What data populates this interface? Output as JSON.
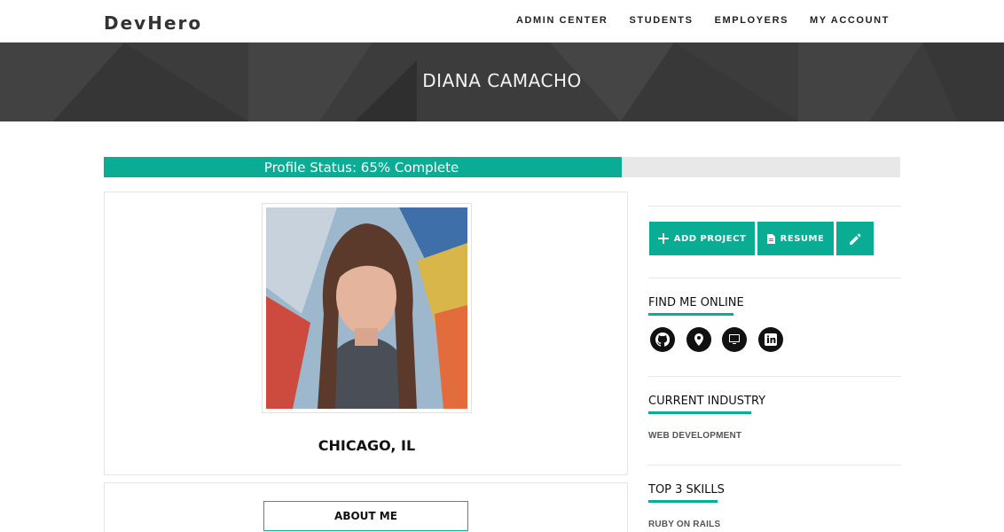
{
  "brand": "DevHero",
  "nav": [
    "ADMIN CENTER",
    "STUDENTS",
    "EMPLOYERS",
    "MY ACCOUNT"
  ],
  "banner": {
    "title": "DIANA CAMACHO"
  },
  "profile_status": {
    "label": "Profile Status:  65% Complete",
    "percent": 65
  },
  "profile": {
    "location": "CHICAGO, IL",
    "about_button": "ABOUT ME"
  },
  "actions": {
    "add_project": "ADD PROJECT",
    "resume": "RESUME"
  },
  "find_me": {
    "title": "FIND ME ONLINE",
    "links": [
      "github-icon",
      "location-pin-icon",
      "monitor-icon",
      "linkedin-icon"
    ]
  },
  "industry": {
    "title": "CURRENT INDUSTRY",
    "value": "WEB DEVELOPMENT"
  },
  "skills": {
    "title": "TOP 3 SKILLS",
    "items": [
      "RUBY ON RAILS"
    ]
  },
  "colors": {
    "accent": "#0aac94",
    "banner": "#3c3c3c",
    "progress_track": "#e8e8e8"
  }
}
